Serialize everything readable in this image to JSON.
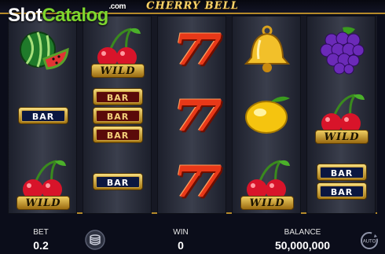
{
  "header": {
    "title": "CHERRY BELL"
  },
  "watermark": {
    "slot": "Slot",
    "catalog": "Catalog",
    "com": ".com"
  },
  "reels": [
    [
      "watermelon",
      "bar",
      "cherry-wild"
    ],
    [
      "cherry-wild",
      "triple-bar",
      "bar"
    ],
    [
      "seven",
      "seven",
      "seven"
    ],
    [
      "bell",
      "lemon",
      "cherry-wild"
    ],
    [
      "grapes",
      "cherry-wild",
      "double-bar"
    ]
  ],
  "symbols": {
    "wild": "WILD",
    "bar": "BAR"
  },
  "bottom": {
    "bet_label": "BET",
    "bet_value": "0.2",
    "win_label": "WIN",
    "win_value": "0",
    "balance_label": "BALANCE",
    "balance_value": "50,000,000",
    "auto_label": "AUTO"
  },
  "colors": {
    "gold": "#b58a2a",
    "background": "#0b0d1a",
    "reel": "#2b2f3c"
  }
}
